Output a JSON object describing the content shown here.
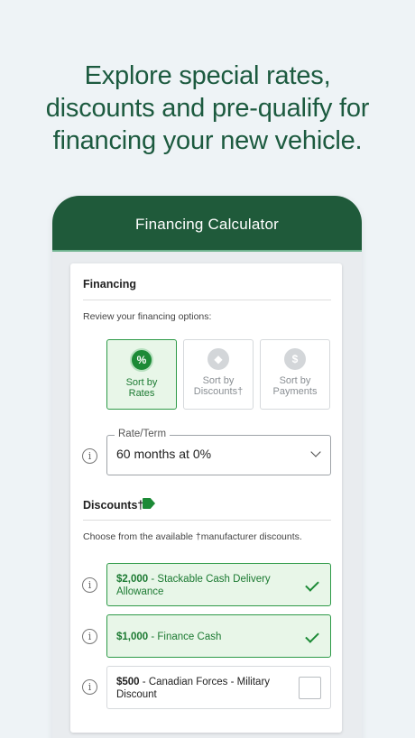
{
  "headline": {
    "lines": [
      "Explore special rates,",
      "discounts and pre-qualify for",
      "financing your new vehicle."
    ]
  },
  "app": {
    "title": "Financing Calculator"
  },
  "financing": {
    "heading": "Financing",
    "subtext": "Review your financing options:",
    "sort_options": [
      {
        "icon": "percent-icon",
        "glyph": "%",
        "line1": "Sort by",
        "line2": "Rates",
        "selected": true
      },
      {
        "icon": "tag-icon",
        "glyph": "◆",
        "line1": "Sort by",
        "line2": "Discounts†",
        "selected": false
      },
      {
        "icon": "dollar-icon",
        "glyph": "$",
        "line1": "Sort by",
        "line2": "Payments",
        "selected": false
      }
    ],
    "rate_term": {
      "label": "Rate/Term",
      "value": "60 months at 0%"
    }
  },
  "discounts": {
    "heading": "Discounts†",
    "subtext": "Choose from the available †manufacturer discounts.",
    "items": [
      {
        "amount": "$2,000",
        "line1": " - Stackable Cash Delivery",
        "line2": "Allowance",
        "selected": true
      },
      {
        "amount": "$1,000",
        "line1": " - Finance Cash",
        "line2": "",
        "selected": true
      },
      {
        "amount": "$500",
        "line1": " - Canadian Forces - Military",
        "line2": "Discount",
        "selected": false
      }
    ]
  },
  "colors": {
    "brand_green": "#1f5a3a",
    "accent_green": "#1c8a36",
    "selected_bg": "#e8f6e8"
  }
}
